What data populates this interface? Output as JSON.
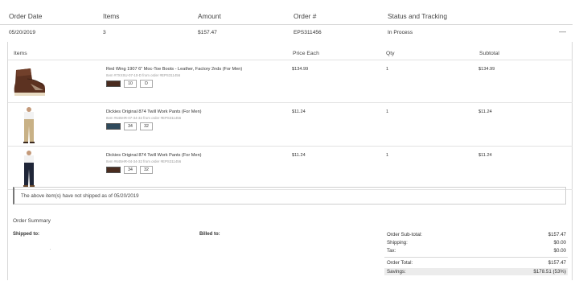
{
  "header": {
    "order_date": "Order Date",
    "items": "Items",
    "amount": "Amount",
    "order_num": "Order #",
    "status": "Status and Tracking"
  },
  "order": {
    "date": "05/20/2019",
    "items": "3",
    "amount": "$157.47",
    "number": "EPS311456",
    "status": "In Process",
    "collapse": "—"
  },
  "items_table": {
    "headers": {
      "items": "Items",
      "price": "Price Each",
      "qty": "Qty",
      "subtotal": "Subtotal"
    },
    "rows": [
      {
        "name": "Red Wing 1907 6\" Moc-Toe Boots - Leather, Factory 2nds (For Men)",
        "sku": "Item #7XXSU-07-10-D from order #EPS311456",
        "size_a": "10",
        "size_b": "D",
        "swatch_color": "#4a2c1f",
        "price": "$134.99",
        "qty": "1",
        "subtotal": "$134.99",
        "thumb_icon": "brown-boot-icon"
      },
      {
        "name": "Dickies Original 874 Twill Work Pants (For Men)",
        "sku": "Item #645HR-07-34-32 from order #EPS311456",
        "size_a": "34",
        "size_b": "32",
        "swatch_color": "#2f4a5c",
        "price": "$11.24",
        "qty": "1",
        "subtotal": "$11.24",
        "thumb_icon": "khaki-pants-icon"
      },
      {
        "name": "Dickies Original 874 Twill Work Pants (For Men)",
        "sku": "Item #645HR-04-34-32 from order #EPS311456",
        "size_a": "34",
        "size_b": "32",
        "swatch_color": "#4a2c1f",
        "price": "$11.24",
        "qty": "1",
        "subtotal": "$11.24",
        "thumb_icon": "navy-pants-icon"
      }
    ]
  },
  "notice": "The above item(s) have not shipped as of 05/20/2019",
  "summary": {
    "title": "Order Summary",
    "shipped_to": "Shipped to:",
    "billed_to": "Billed to:",
    "totals": [
      {
        "label": "Order Sub-total:",
        "value": "$157.47"
      },
      {
        "label": "Shipping:",
        "value": "$0.00"
      },
      {
        "label": "Tax:",
        "value": "$0.00"
      },
      {
        "label": "Order Total:",
        "value": "$157.47"
      },
      {
        "label": "Savings:",
        "value": "$178.51 (53%)"
      }
    ]
  }
}
